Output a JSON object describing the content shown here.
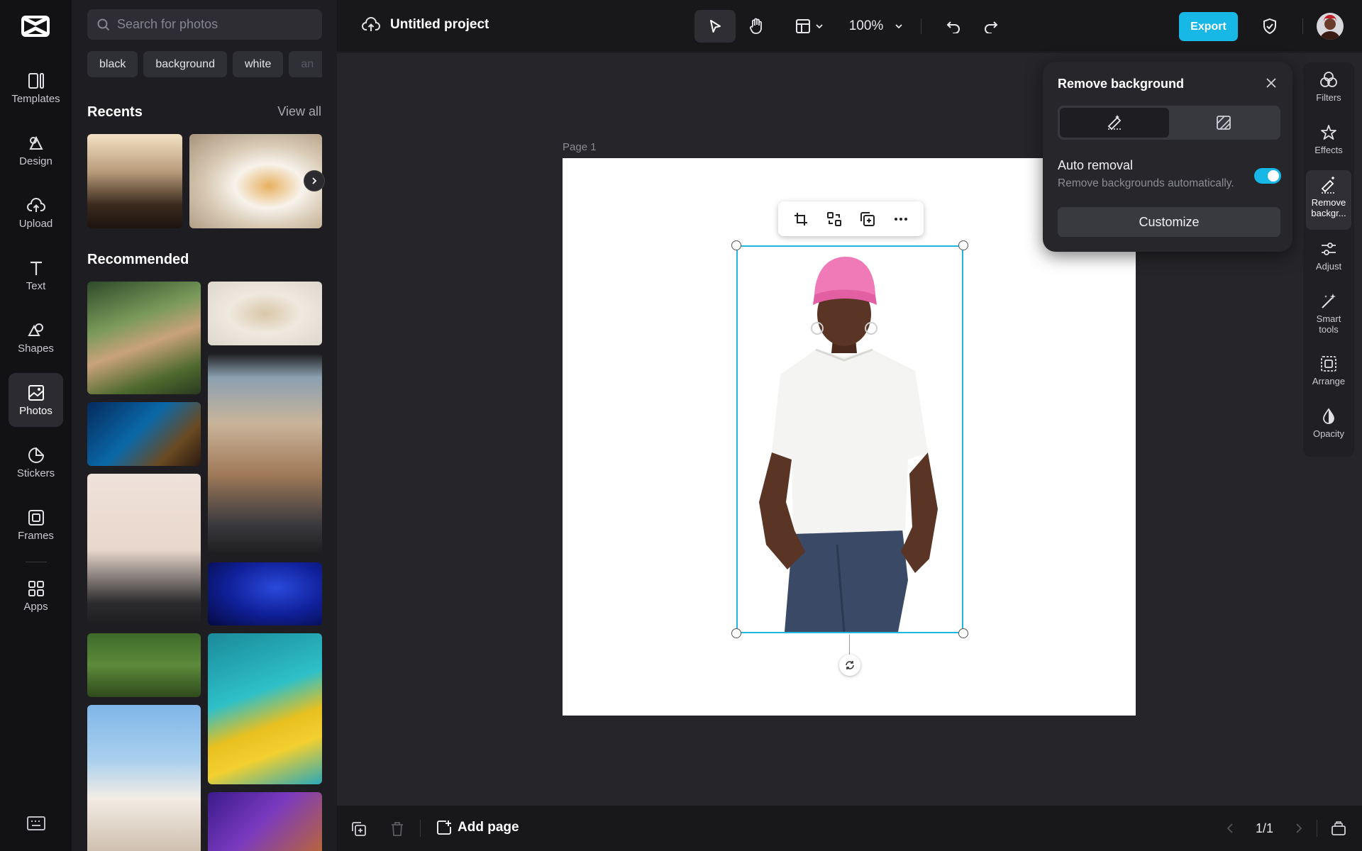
{
  "rail": {
    "items": [
      {
        "label": "Templates",
        "icon": "templates-icon"
      },
      {
        "label": "Design",
        "icon": "design-icon"
      },
      {
        "label": "Upload",
        "icon": "upload-icon"
      },
      {
        "label": "Text",
        "icon": "text-icon"
      },
      {
        "label": "Shapes",
        "icon": "shapes-icon"
      },
      {
        "label": "Photos",
        "icon": "photos-icon",
        "active": true
      },
      {
        "label": "Stickers",
        "icon": "stickers-icon"
      },
      {
        "label": "Frames",
        "icon": "frames-icon"
      },
      {
        "label": "Apps",
        "icon": "apps-icon"
      }
    ]
  },
  "panel": {
    "search_placeholder": "Search for photos",
    "chips": [
      "black",
      "background",
      "white",
      "an"
    ],
    "recents_title": "Recents",
    "view_all": "View all",
    "recommended_title": "Recommended"
  },
  "topbar": {
    "project_title": "Untitled project",
    "zoom": "100%",
    "export": "Export"
  },
  "canvas": {
    "page_label": "Page 1"
  },
  "remove_bg": {
    "title": "Remove background",
    "auto_title": "Auto removal",
    "auto_desc": "Remove backgrounds automatically.",
    "auto_enabled": true,
    "customize": "Customize"
  },
  "right_rail": {
    "items": [
      {
        "label": "Filters"
      },
      {
        "label": "Effects"
      },
      {
        "label": "Remove backgr..."
      },
      {
        "label": "Adjust"
      },
      {
        "label": "Smart tools"
      },
      {
        "label": "Arrange"
      },
      {
        "label": "Opacity"
      }
    ]
  },
  "bottombar": {
    "add_page": "Add page",
    "pager": "1/1"
  },
  "colors": {
    "accent": "#17b7e6",
    "selection": "#20b8e0"
  }
}
